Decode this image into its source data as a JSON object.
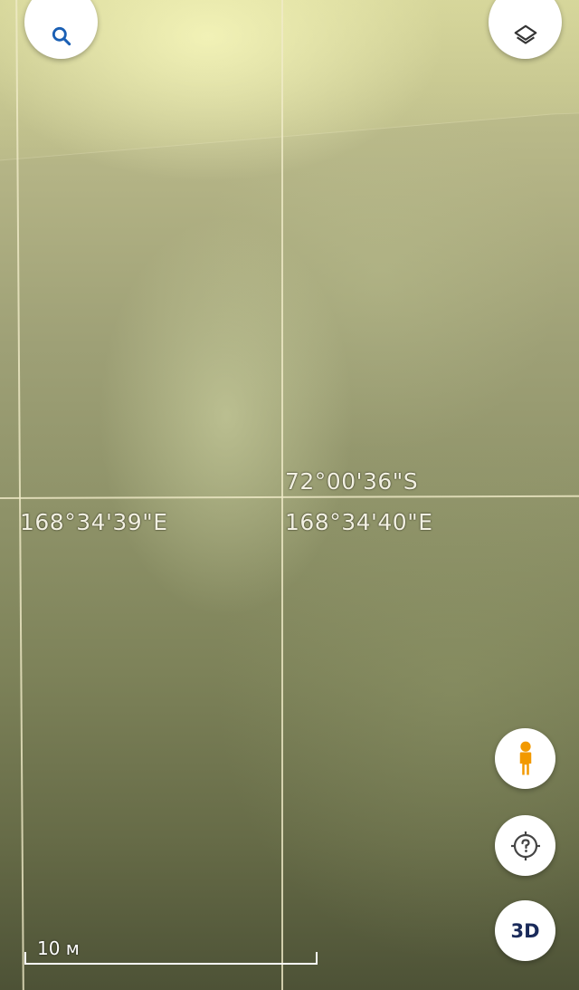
{
  "map": {
    "latitude_label": "72°00'36\"S",
    "longitude_labels": [
      "168°34'39\"E",
      "168°34'40\"E"
    ]
  },
  "controls": {
    "search_icon": "search-icon",
    "layers_icon": "layers-icon",
    "street_view_icon": "pegman-icon",
    "location_icon": "crosshair-question-icon",
    "three_d_label": "3D"
  },
  "scale": {
    "label": "10 м"
  },
  "colors": {
    "accent_blue": "#1a5fb4",
    "pegman_orange": "#f29900",
    "three_d_text": "#1a2a5a"
  }
}
